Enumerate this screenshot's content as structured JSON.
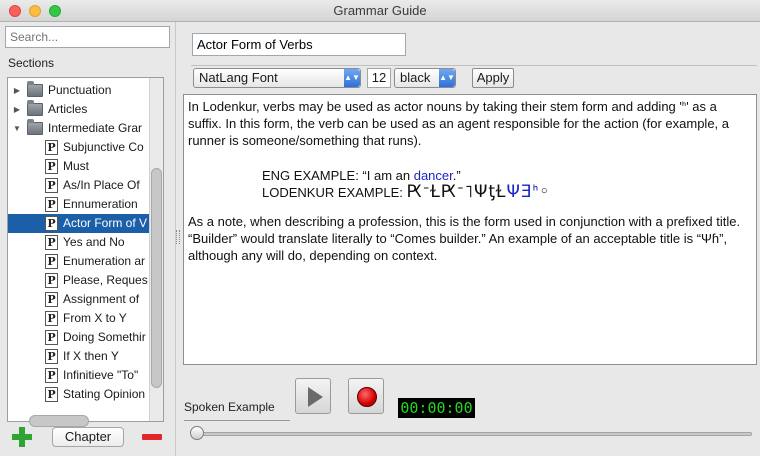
{
  "window": {
    "title": "Grammar Guide"
  },
  "sidebar": {
    "search_placeholder": "Search...",
    "sections_label": "Sections",
    "items": [
      {
        "label": "Punctuation",
        "kind": "folder",
        "expanded": false
      },
      {
        "label": "Articles",
        "kind": "folder",
        "expanded": false
      },
      {
        "label": "Intermediate Grar",
        "kind": "folder",
        "expanded": true
      },
      {
        "label": "Subjunctive Co",
        "kind": "page"
      },
      {
        "label": "Must",
        "kind": "page"
      },
      {
        "label": "As/In Place Of",
        "kind": "page"
      },
      {
        "label": "Ennumeration",
        "kind": "page"
      },
      {
        "label": "Actor Form of V",
        "kind": "page",
        "selected": true
      },
      {
        "label": "Yes and No",
        "kind": "page"
      },
      {
        "label": "Enumeration ar",
        "kind": "page"
      },
      {
        "label": "Please, Reques",
        "kind": "page"
      },
      {
        "label": "Assignment of",
        "kind": "page"
      },
      {
        "label": "From X to Y",
        "kind": "page"
      },
      {
        "label": "Doing Somethir",
        "kind": "page"
      },
      {
        "label": "If X then Y",
        "kind": "page"
      },
      {
        "label": "Infinitieve \"To\"",
        "kind": "page"
      },
      {
        "label": "Stating Opinion",
        "kind": "page"
      }
    ],
    "chapter_button": "Chapter"
  },
  "editor": {
    "section_title": "Actor Form of Verbs",
    "font_select": "NatLang Font",
    "font_size": "12",
    "color_select": "black",
    "apply_label": "Apply",
    "para1": "In Lodenkur, verbs may be used as actor nouns by taking their stem form and adding 'ᑋ' as a suffix. In this form, the verb can be used as an agent responsible for the action (for example, a runner is someone/something that runs).",
    "eng_example_prefix": "ENG EXAMPLE: “I am an ",
    "eng_example_word": "dancer",
    "eng_example_suffix": ".”",
    "lod_example_label": "LODENKUR EXAMPLE: ",
    "lod_glyphs_black": "ԖᐨⱢԖᐨ˥ΨƫⱢ",
    "lod_glyphs_blue": "ΨƎᑋ",
    "lod_glyphs_end": "◦",
    "para2": "As a note, when describing a profession, this is the form used in conjunction with a prefixed title. “Builder” would translate literally to “Comes builder.” An example of an acceptable title is “Ψɦ”, although any will do, depending on context."
  },
  "audio": {
    "label": "Spoken Example",
    "timer": "00:00:00"
  },
  "colors": {
    "selection": "#1b5fa8",
    "link_blue": "#1a25c8",
    "timer_green": "#1fd81f",
    "add_green": "#2fa433",
    "remove_red": "#e0272b"
  }
}
